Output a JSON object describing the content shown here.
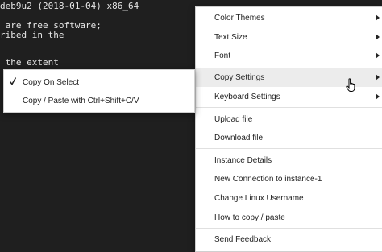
{
  "terminal": {
    "lines": [
      "deb9u2 (2018-01-04) x86_64",
      "",
      " are free software;",
      "ribed in the",
      "",
      "",
      " the extent"
    ]
  },
  "menu": {
    "items": [
      {
        "label": "Color Themes"
      },
      {
        "label": "Text Size"
      },
      {
        "label": "Font"
      },
      {
        "label": "Copy Settings"
      },
      {
        "label": "Keyboard Settings"
      },
      {
        "label": "Upload file"
      },
      {
        "label": "Download file"
      },
      {
        "label": "Instance Details"
      },
      {
        "label": "New Connection to instance-1"
      },
      {
        "label": "Change Linux Username"
      },
      {
        "label": "How to copy / paste"
      },
      {
        "label": "Send Feedback"
      }
    ]
  },
  "submenu": {
    "items": [
      {
        "label": "Copy On Select",
        "checked": true
      },
      {
        "label": "Copy / Paste with Ctrl+Shift+C/V",
        "checked": false
      }
    ]
  },
  "colors": {
    "terminal_bg": "#1f1f1f",
    "menu_bg": "#ffffff",
    "highlight": "#ececec",
    "text": "#222222"
  },
  "icons": [
    "chevron-right-icon",
    "checkmark-icon",
    "hand-cursor-icon"
  ]
}
